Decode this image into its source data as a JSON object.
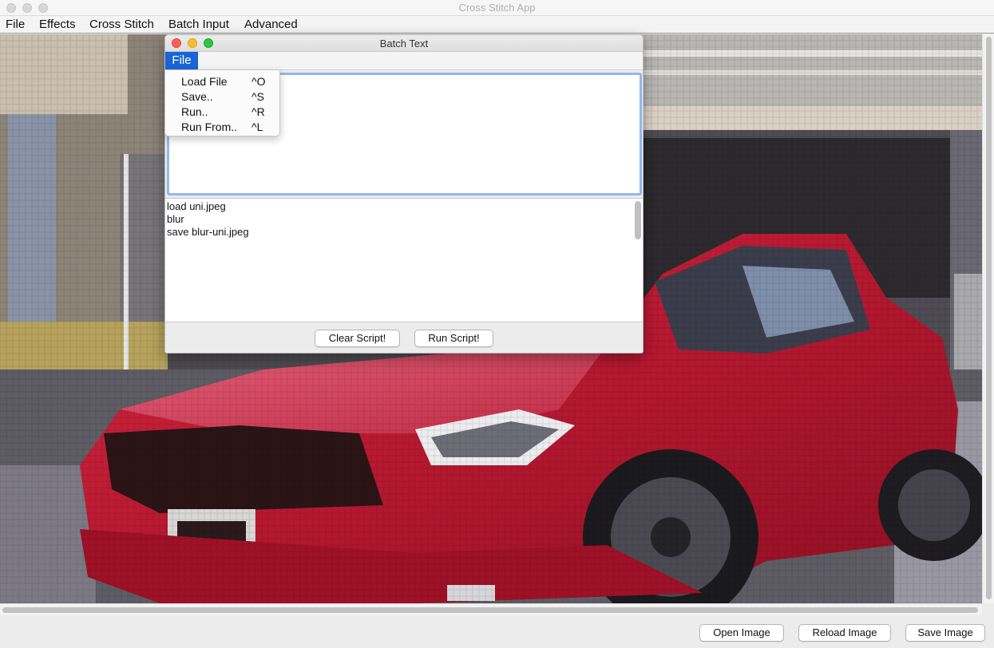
{
  "app": {
    "title": "Cross Stitch App",
    "menu": [
      "File",
      "Effects",
      "Cross Stitch",
      "Batch Input",
      "Advanced"
    ]
  },
  "batch_window": {
    "title": "Batch Text",
    "menu_file": "File",
    "input_value": "",
    "script_lines": [
      "load uni.jpeg",
      "blur",
      "save blur-uni.jpeg"
    ],
    "clear_button": "Clear Script!",
    "run_button": "Run Script!"
  },
  "file_dropdown": {
    "items": [
      {
        "label": "Load File",
        "shortcut": "^O"
      },
      {
        "label": "Save..",
        "shortcut": "^S"
      },
      {
        "label": "Run..",
        "shortcut": "^R"
      },
      {
        "label": "Run From..",
        "shortcut": "^L"
      }
    ]
  },
  "bottom_buttons": {
    "open": "Open Image",
    "reload": "Reload Image",
    "save": "Save Image"
  },
  "colors": {
    "menu_highlight": "#1a64d8",
    "close": "#fe5f57",
    "minimize": "#febc2e",
    "zoom": "#28c840"
  }
}
